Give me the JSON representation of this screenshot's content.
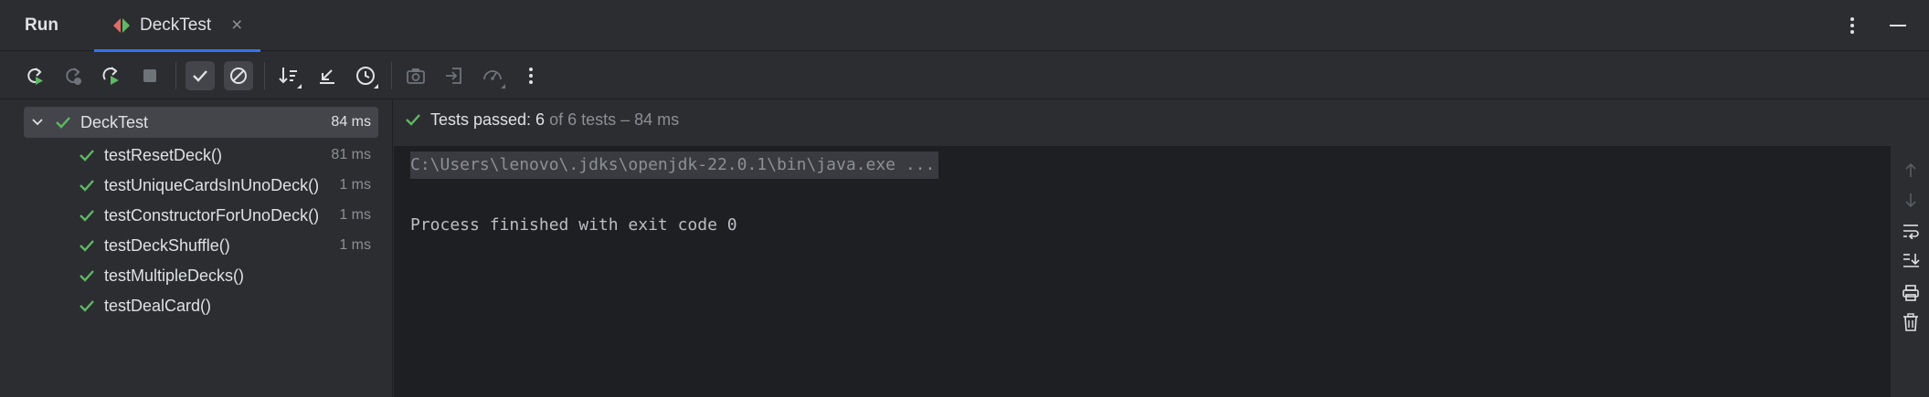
{
  "header": {
    "title": "Run",
    "tab": {
      "label": "DeckTest",
      "icon": "java-test-class-icon"
    },
    "actions": [
      "more-vertical-icon",
      "minimize-icon"
    ]
  },
  "toolbar": {
    "buttons": [
      {
        "name": "rerun-icon"
      },
      {
        "name": "rerun-failed-icon"
      },
      {
        "name": "rerun-automatically-icon"
      },
      {
        "name": "stop-icon"
      },
      {
        "name": "show-passed-icon",
        "active": true
      },
      {
        "name": "show-ignored-icon",
        "active": true
      },
      {
        "name": "sort-icon"
      },
      {
        "name": "collapse-all-icon"
      },
      {
        "name": "test-history-icon"
      },
      {
        "name": "export-icon"
      },
      {
        "name": "import-tests-icon"
      },
      {
        "name": "coverage-gauge-icon"
      },
      {
        "name": "more-vertical-icon"
      }
    ]
  },
  "tree": {
    "root": {
      "label": "DeckTest",
      "duration": "84 ms",
      "expanded": true,
      "status": "passed"
    },
    "items": [
      {
        "label": "testResetDeck()",
        "duration": "81 ms",
        "status": "passed"
      },
      {
        "label": "testUniqueCardsInUnoDeck()",
        "duration": "1 ms",
        "status": "passed"
      },
      {
        "label": "testConstructorForUnoDeck()",
        "duration": "1 ms",
        "status": "passed"
      },
      {
        "label": "testDeckShuffle()",
        "duration": "1 ms",
        "status": "passed"
      },
      {
        "label": "testMultipleDecks()",
        "duration": "",
        "status": "passed"
      },
      {
        "label": "testDealCard()",
        "duration": "",
        "status": "passed"
      }
    ]
  },
  "status": {
    "prefix": "Tests passed: 6",
    "rest": " of 6 tests – 84 ms"
  },
  "console": {
    "command": "C:\\Users\\lenovo\\.jdks\\openjdk-22.0.1\\bin\\java.exe ...",
    "exit_message": "Process finished with exit code 0"
  },
  "gutter": [
    "up-arrow-icon",
    "down-arrow-icon",
    "soft-wrap-icon",
    "scroll-to-end-icon",
    "print-icon",
    "trash-icon"
  ],
  "colors": {
    "background": "#2b2d30",
    "console_bg": "#1e1f22",
    "accent": "#3574f0",
    "pass_green": "#5fb865",
    "text": "#dfe1e5",
    "muted": "#8c8f94"
  }
}
